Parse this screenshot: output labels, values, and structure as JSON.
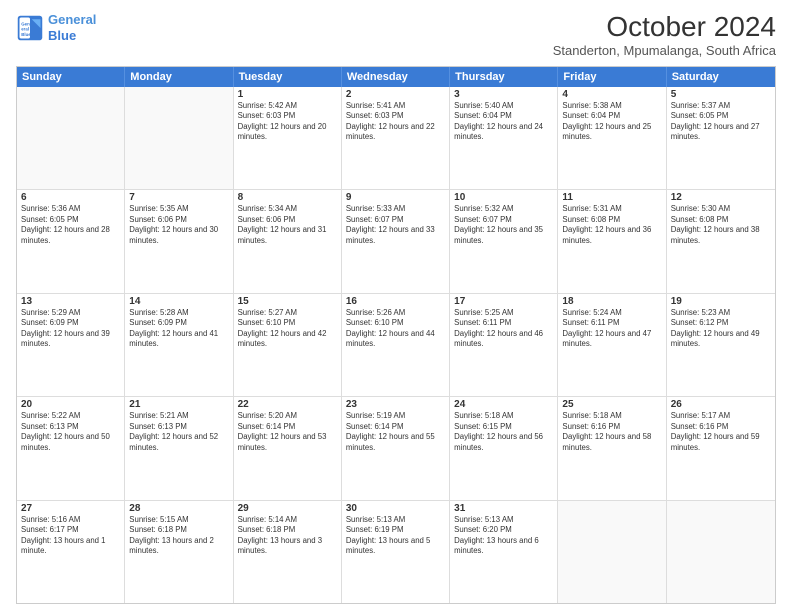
{
  "logo": {
    "line1": "General",
    "line2": "Blue"
  },
  "title": "October 2024",
  "subtitle": "Standerton, Mpumalanga, South Africa",
  "days_of_week": [
    "Sunday",
    "Monday",
    "Tuesday",
    "Wednesday",
    "Thursday",
    "Friday",
    "Saturday"
  ],
  "weeks": [
    [
      {
        "day": "",
        "text": ""
      },
      {
        "day": "",
        "text": ""
      },
      {
        "day": "1",
        "text": "Sunrise: 5:42 AM\nSunset: 6:03 PM\nDaylight: 12 hours and 20 minutes."
      },
      {
        "day": "2",
        "text": "Sunrise: 5:41 AM\nSunset: 6:03 PM\nDaylight: 12 hours and 22 minutes."
      },
      {
        "day": "3",
        "text": "Sunrise: 5:40 AM\nSunset: 6:04 PM\nDaylight: 12 hours and 24 minutes."
      },
      {
        "day": "4",
        "text": "Sunrise: 5:38 AM\nSunset: 6:04 PM\nDaylight: 12 hours and 25 minutes."
      },
      {
        "day": "5",
        "text": "Sunrise: 5:37 AM\nSunset: 6:05 PM\nDaylight: 12 hours and 27 minutes."
      }
    ],
    [
      {
        "day": "6",
        "text": "Sunrise: 5:36 AM\nSunset: 6:05 PM\nDaylight: 12 hours and 28 minutes."
      },
      {
        "day": "7",
        "text": "Sunrise: 5:35 AM\nSunset: 6:06 PM\nDaylight: 12 hours and 30 minutes."
      },
      {
        "day": "8",
        "text": "Sunrise: 5:34 AM\nSunset: 6:06 PM\nDaylight: 12 hours and 31 minutes."
      },
      {
        "day": "9",
        "text": "Sunrise: 5:33 AM\nSunset: 6:07 PM\nDaylight: 12 hours and 33 minutes."
      },
      {
        "day": "10",
        "text": "Sunrise: 5:32 AM\nSunset: 6:07 PM\nDaylight: 12 hours and 35 minutes."
      },
      {
        "day": "11",
        "text": "Sunrise: 5:31 AM\nSunset: 6:08 PM\nDaylight: 12 hours and 36 minutes."
      },
      {
        "day": "12",
        "text": "Sunrise: 5:30 AM\nSunset: 6:08 PM\nDaylight: 12 hours and 38 minutes."
      }
    ],
    [
      {
        "day": "13",
        "text": "Sunrise: 5:29 AM\nSunset: 6:09 PM\nDaylight: 12 hours and 39 minutes."
      },
      {
        "day": "14",
        "text": "Sunrise: 5:28 AM\nSunset: 6:09 PM\nDaylight: 12 hours and 41 minutes."
      },
      {
        "day": "15",
        "text": "Sunrise: 5:27 AM\nSunset: 6:10 PM\nDaylight: 12 hours and 42 minutes."
      },
      {
        "day": "16",
        "text": "Sunrise: 5:26 AM\nSunset: 6:10 PM\nDaylight: 12 hours and 44 minutes."
      },
      {
        "day": "17",
        "text": "Sunrise: 5:25 AM\nSunset: 6:11 PM\nDaylight: 12 hours and 46 minutes."
      },
      {
        "day": "18",
        "text": "Sunrise: 5:24 AM\nSunset: 6:11 PM\nDaylight: 12 hours and 47 minutes."
      },
      {
        "day": "19",
        "text": "Sunrise: 5:23 AM\nSunset: 6:12 PM\nDaylight: 12 hours and 49 minutes."
      }
    ],
    [
      {
        "day": "20",
        "text": "Sunrise: 5:22 AM\nSunset: 6:13 PM\nDaylight: 12 hours and 50 minutes."
      },
      {
        "day": "21",
        "text": "Sunrise: 5:21 AM\nSunset: 6:13 PM\nDaylight: 12 hours and 52 minutes."
      },
      {
        "day": "22",
        "text": "Sunrise: 5:20 AM\nSunset: 6:14 PM\nDaylight: 12 hours and 53 minutes."
      },
      {
        "day": "23",
        "text": "Sunrise: 5:19 AM\nSunset: 6:14 PM\nDaylight: 12 hours and 55 minutes."
      },
      {
        "day": "24",
        "text": "Sunrise: 5:18 AM\nSunset: 6:15 PM\nDaylight: 12 hours and 56 minutes."
      },
      {
        "day": "25",
        "text": "Sunrise: 5:18 AM\nSunset: 6:16 PM\nDaylight: 12 hours and 58 minutes."
      },
      {
        "day": "26",
        "text": "Sunrise: 5:17 AM\nSunset: 6:16 PM\nDaylight: 12 hours and 59 minutes."
      }
    ],
    [
      {
        "day": "27",
        "text": "Sunrise: 5:16 AM\nSunset: 6:17 PM\nDaylight: 13 hours and 1 minute."
      },
      {
        "day": "28",
        "text": "Sunrise: 5:15 AM\nSunset: 6:18 PM\nDaylight: 13 hours and 2 minutes."
      },
      {
        "day": "29",
        "text": "Sunrise: 5:14 AM\nSunset: 6:18 PM\nDaylight: 13 hours and 3 minutes."
      },
      {
        "day": "30",
        "text": "Sunrise: 5:13 AM\nSunset: 6:19 PM\nDaylight: 13 hours and 5 minutes."
      },
      {
        "day": "31",
        "text": "Sunrise: 5:13 AM\nSunset: 6:20 PM\nDaylight: 13 hours and 6 minutes."
      },
      {
        "day": "",
        "text": ""
      },
      {
        "day": "",
        "text": ""
      }
    ]
  ]
}
